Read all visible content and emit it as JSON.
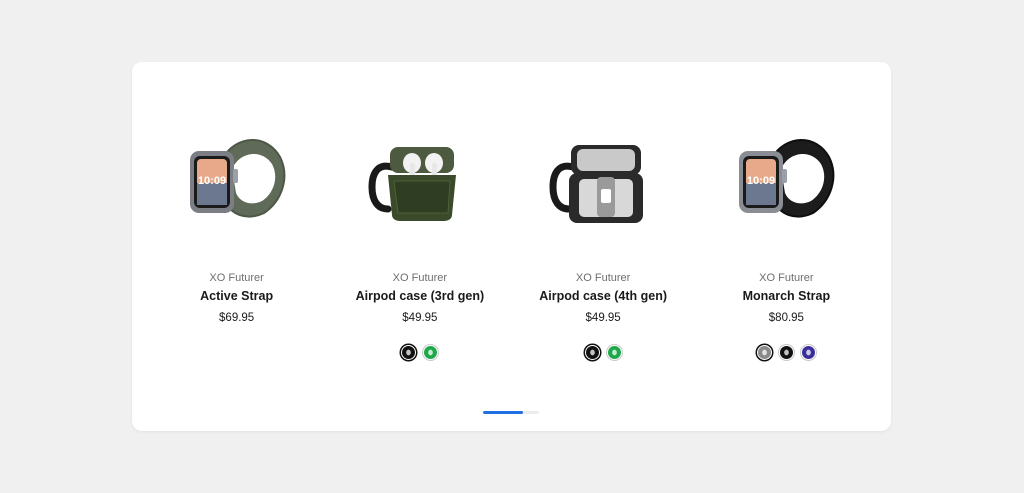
{
  "carousel": {
    "progress": 0.72,
    "accent_color": "#1f6fe5",
    "products": [
      {
        "brand": "XO Futurer",
        "name": "Active Strap",
        "price": "$69.95",
        "icon": "watch-strap-olive-icon",
        "swatches": []
      },
      {
        "brand": "XO Futurer",
        "name": "Airpod case (3rd gen)",
        "price": "$49.95",
        "icon": "airpod-case-green-icon",
        "swatches": [
          {
            "color": "#111111",
            "selected": true
          },
          {
            "color": "#1fa84a",
            "selected": false
          }
        ]
      },
      {
        "brand": "XO Futurer",
        "name": "Airpod case (4th gen)",
        "price": "$49.95",
        "icon": "airpod-case-black-icon",
        "swatches": [
          {
            "color": "#111111",
            "selected": true
          },
          {
            "color": "#1fa84a",
            "selected": false
          }
        ]
      },
      {
        "brand": "XO Futurer",
        "name": "Monarch Strap",
        "price": "$80.95",
        "icon": "watch-strap-black-icon",
        "swatches": [
          {
            "color": "#8a8a8a",
            "selected": true
          },
          {
            "color": "#111111",
            "selected": false
          },
          {
            "color": "#3a2f9a",
            "selected": false
          }
        ]
      }
    ]
  }
}
